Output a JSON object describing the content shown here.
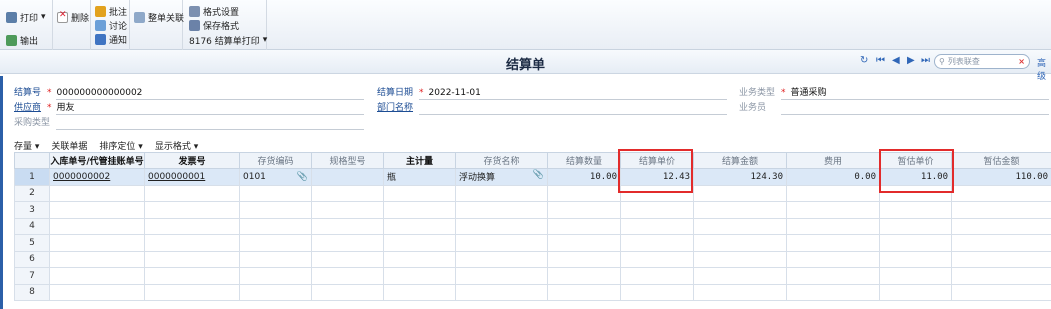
{
  "toolbar": {
    "print": "打印",
    "export": "输出",
    "delete": "删除",
    "annotate": "批注",
    "discuss": "讨论",
    "notify": "通知",
    "whole_link": "整单关联",
    "format_settings": "格式设置",
    "save_format": "保存格式",
    "template": "8176 结算单打印"
  },
  "header": {
    "title": "结算单",
    "search_placeholder": "列表联查",
    "advanced": "高级"
  },
  "form": {
    "settlement_no_label": "结算号",
    "settlement_no": "000000000000002",
    "supplier_label": "供应商",
    "supplier": "用友",
    "purchase_type_label": "采购类型",
    "settlement_date_label": "结算日期",
    "settlement_date": "2022-11-01",
    "department_label": "部门名称",
    "business_type_label": "业务类型",
    "business_type": "普通采购",
    "salesperson_label": "业务员"
  },
  "subtoolbar": {
    "inventory": "存量",
    "related_docs": "关联单据",
    "sort": "排序定位",
    "display_format": "显示格式"
  },
  "table": {
    "columns": [
      "",
      "入库单号/代管挂账单号",
      "发票号",
      "存货编码",
      "规格型号",
      "主计量",
      "存货名称",
      "结算数量",
      "结算单价",
      "结算金额",
      "费用",
      "暂估单价",
      "暂估金额"
    ],
    "rows": [
      {
        "no": "1",
        "receipt": "0000000002",
        "invoice": "0000000001",
        "code": "0101",
        "spec": "",
        "unit": "瓶",
        "name": "浮动换算",
        "qty": "10.00",
        "price": "12.43",
        "amount": "124.30",
        "fee": "0.00",
        "est_price": "11.00",
        "est_amount": "110.00"
      },
      {
        "no": "2"
      },
      {
        "no": "3"
      },
      {
        "no": "4"
      },
      {
        "no": "5"
      },
      {
        "no": "6"
      },
      {
        "no": "7"
      },
      {
        "no": "8"
      }
    ]
  }
}
